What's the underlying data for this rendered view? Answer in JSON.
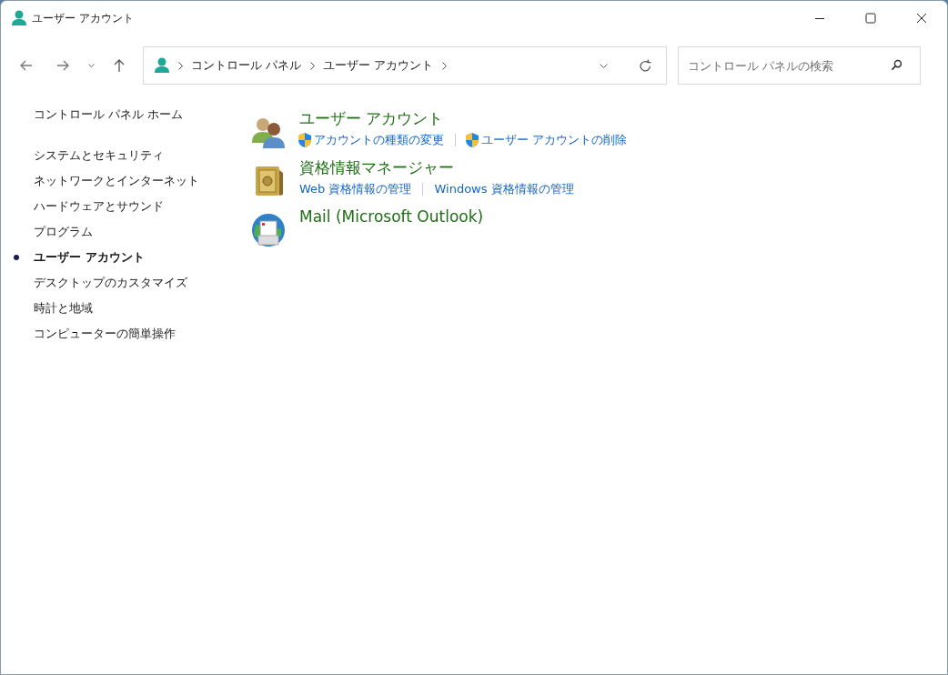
{
  "window": {
    "title": "ユーザー アカウント"
  },
  "address_bar": {
    "crumbs": [
      "コントロール パネル",
      "ユーザー アカウント"
    ]
  },
  "search": {
    "placeholder": "コントロール パネルの検索"
  },
  "sidebar": {
    "home": "コントロール パネル ホーム",
    "items": [
      {
        "label": "システムとセキュリティ",
        "selected": false
      },
      {
        "label": "ネットワークとインターネット",
        "selected": false
      },
      {
        "label": "ハードウェアとサウンド",
        "selected": false
      },
      {
        "label": "プログラム",
        "selected": false
      },
      {
        "label": "ユーザー アカウント",
        "selected": true
      },
      {
        "label": "デスクトップのカスタマイズ",
        "selected": false
      },
      {
        "label": "時計と地域",
        "selected": false
      },
      {
        "label": "コンピューターの簡単操作",
        "selected": false
      }
    ]
  },
  "categories": [
    {
      "kind": "users",
      "title": "ユーザー アカウント",
      "links": [
        {
          "label": "アカウントの種類の変更",
          "shield": true
        },
        {
          "label": "ユーザー アカウントの削除",
          "shield": true
        }
      ]
    },
    {
      "kind": "safe",
      "title": "資格情報マネージャー",
      "links": [
        {
          "label": "Web 資格情報の管理",
          "shield": false
        },
        {
          "label": "Windows 資格情報の管理",
          "shield": false
        }
      ]
    },
    {
      "kind": "mail",
      "title": "Mail (Microsoft Outlook)"
    }
  ]
}
